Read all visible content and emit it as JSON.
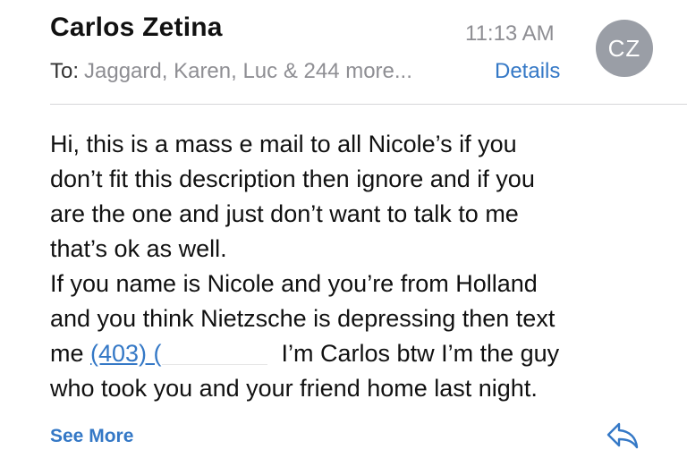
{
  "header": {
    "sender_name": "Carlos Zetina",
    "time": "11:13 AM",
    "avatar_initials": "CZ",
    "to_label": "To:",
    "recipients": "Jaggard, Karen, Luc & 244 more...",
    "details_label": "Details"
  },
  "message": {
    "lines": [
      "Hi, this is a mass e mail to all Nicole’s if you",
      "don’t fit this description then ignore and if you",
      "are the one and just don’t want to talk to me",
      "that’s ok as well.",
      "If you name is Nicole and you’re from Holland",
      "and you think Nietzsche is depressing then text"
    ],
    "line7_prefix": "me ",
    "phone_visible": "(403) (",
    "line7_suffix": "I’m Carlos btw I’m the guy",
    "line8": "who took you and your friend home last night."
  },
  "footer": {
    "see_more_label": "See More",
    "reply_icon": "reply-arrow-icon"
  },
  "colors": {
    "accent": "#3478c6",
    "secondary_text": "#8e8e93",
    "avatar_bg": "#9a9ea6"
  }
}
